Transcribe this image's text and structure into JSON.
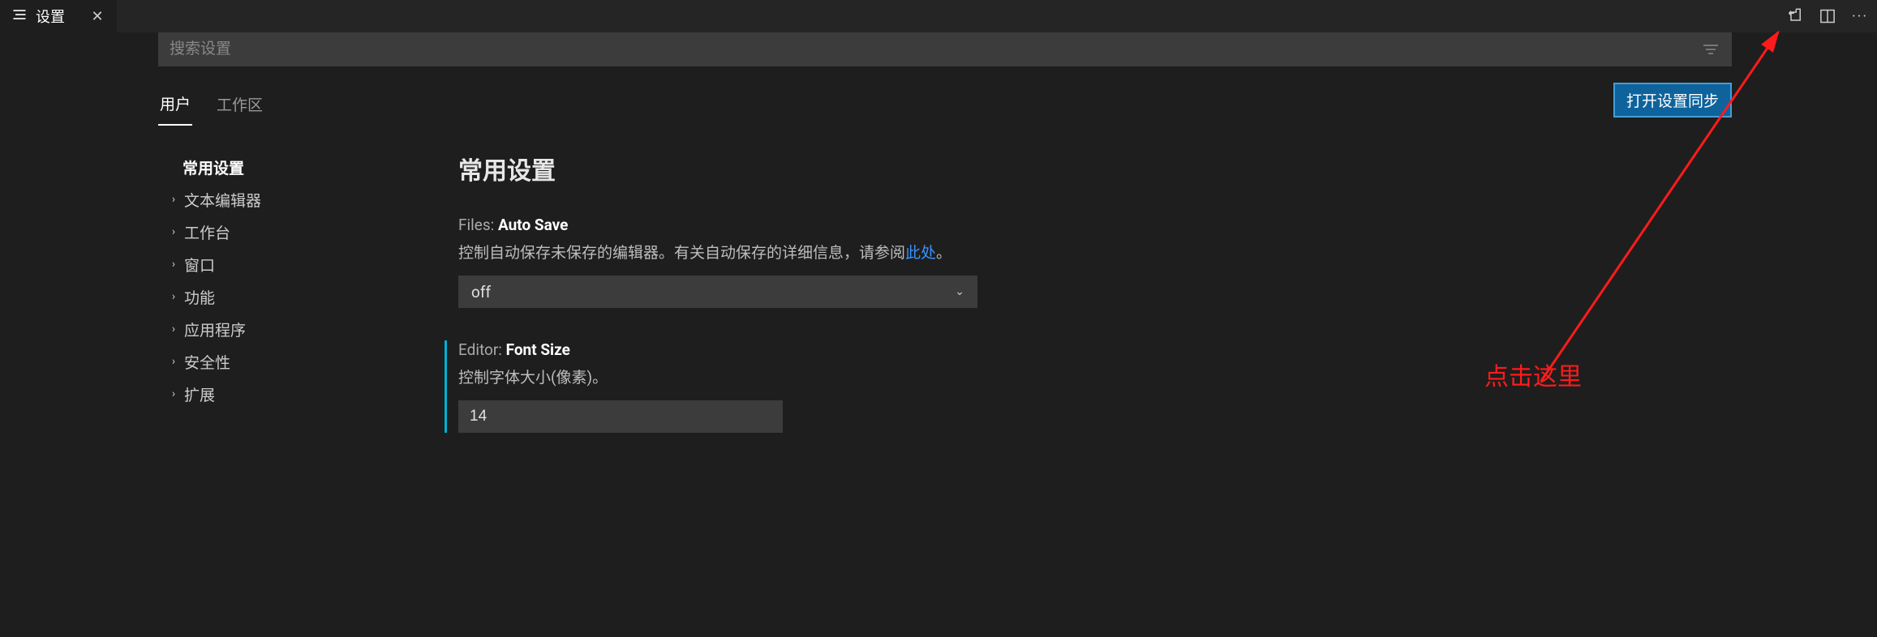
{
  "tab": {
    "title": "设置"
  },
  "search": {
    "placeholder": "搜索设置"
  },
  "scopes": {
    "user": "用户",
    "workspace": "工作区"
  },
  "sync_button": "打开设置同步",
  "tree": {
    "root": "常用设置",
    "items": [
      "文本编辑器",
      "工作台",
      "窗口",
      "功能",
      "应用程序",
      "安全性",
      "扩展"
    ]
  },
  "section_title": "常用设置",
  "settings": {
    "autosave": {
      "scope": "Files:",
      "name": "Auto Save",
      "desc_prefix": "控制自动保存未保存的编辑器。有关自动保存的详细信息，请参阅",
      "desc_link": "此处",
      "desc_suffix": "。",
      "value": "off"
    },
    "fontsize": {
      "scope": "Editor:",
      "name": "Font Size",
      "desc": "控制字体大小(像素)。",
      "value": "14"
    }
  },
  "annotation": {
    "text": "点击这里"
  }
}
